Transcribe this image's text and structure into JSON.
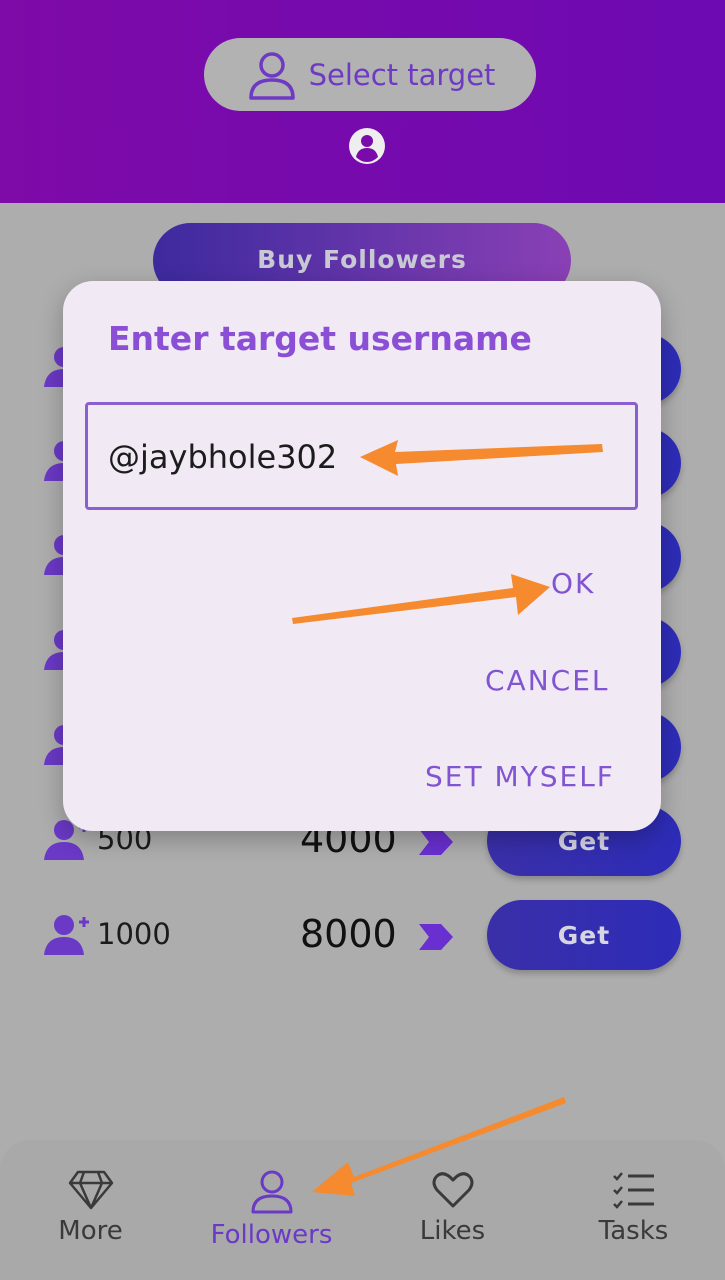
{
  "header": {
    "select_target_label": "Select target"
  },
  "content": {
    "buy_followers_label": "Buy Followers"
  },
  "rows": [
    {
      "count": "500",
      "price": "4000",
      "get_label": "Get"
    },
    {
      "count": "1000",
      "price": "8000",
      "get_label": "Get"
    }
  ],
  "dialog": {
    "title": "Enter target username",
    "input_value": "@jaybhole302",
    "ok_label": "OK",
    "cancel_label": "CANCEL",
    "set_myself_label": "SET MYSELF"
  },
  "nav": {
    "items": [
      {
        "label": "More",
        "icon": "diamond-icon"
      },
      {
        "label": "Followers",
        "icon": "person-icon",
        "active": true
      },
      {
        "label": "Likes",
        "icon": "heart-icon"
      },
      {
        "label": "Tasks",
        "icon": "checklist-icon"
      }
    ]
  },
  "colors": {
    "accent": "#7b4fd1",
    "header": "#7a0aaa",
    "annotation_arrow": "#f58a2e"
  }
}
